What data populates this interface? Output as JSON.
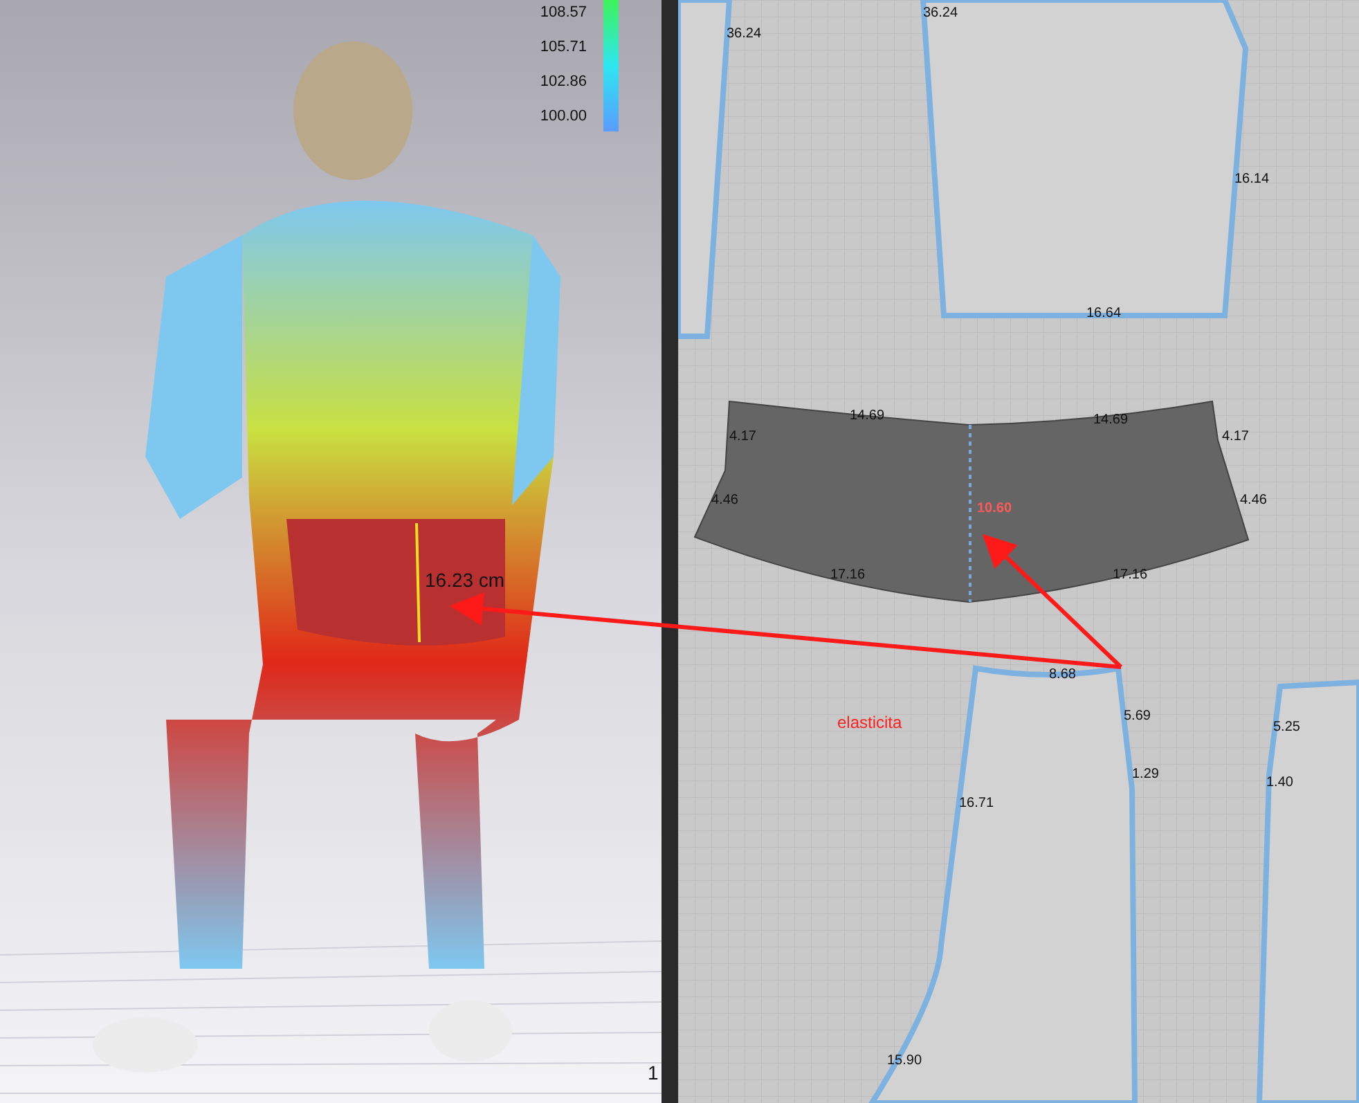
{
  "view_3d": {
    "legend": [
      "108.57",
      "105.71",
      "102.86",
      "100.00"
    ],
    "measurement": "16.23 cm",
    "edge_text": "1"
  },
  "pattern_view": {
    "pieces": [
      {
        "selected": false,
        "labels": [
          "36.24"
        ]
      },
      {
        "selected": false,
        "labels": [
          "36.24",
          "16.14",
          "16.64"
        ]
      },
      {
        "selected": true,
        "labels": [
          "14.69",
          "14.69",
          "4.17",
          "4.17",
          "4.46",
          "4.46",
          "17.16",
          "17.16",
          "10.60"
        ]
      },
      {
        "selected": false,
        "labels": [
          "8.68",
          "5.69",
          "1.29",
          "16.71",
          "15.90"
        ]
      },
      {
        "selected": false,
        "labels": [
          "5.25",
          "1.40"
        ]
      }
    ],
    "annotation": "elasticita"
  }
}
